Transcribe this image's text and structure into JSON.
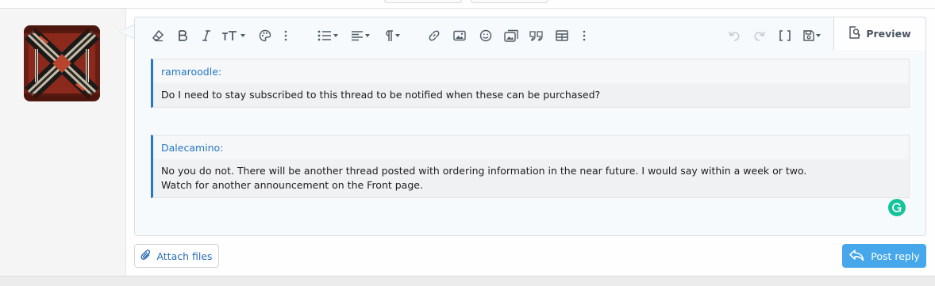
{
  "toolbar": {
    "preview_label": "Preview",
    "buttons": [
      "clear-formatting",
      "bold",
      "italic",
      "font-size",
      "text-color",
      "more-text",
      "list",
      "align",
      "paragraph-format",
      "link",
      "insert-image",
      "smilies",
      "insert-media",
      "quote",
      "insert-table",
      "more-insert",
      "undo",
      "redo",
      "toggle-bb-code",
      "drafts"
    ]
  },
  "quotes": [
    {
      "author": "ramaroodle:",
      "lines": [
        "Do I need to stay subscribed to this thread to be notified when these can be purchased?"
      ]
    },
    {
      "author": "Dalecamino:",
      "lines": [
        "No you do not. There will be another thread posted with ordering information in the near future. I would say within a week or two.",
        "Watch for another announcement on the Front page."
      ]
    }
  ],
  "actions": {
    "attach_label": "Attach files",
    "post_label": "Post reply"
  },
  "colors": {
    "accent": "#2577c8",
    "post_button": "#47a7eb",
    "grammarly": "#15c39a"
  }
}
